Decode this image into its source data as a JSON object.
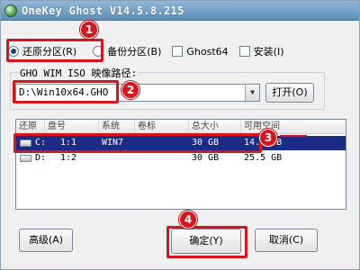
{
  "window": {
    "title": "OneKey Ghost V14.5.8.215"
  },
  "options": {
    "restore": "还原分区(R)",
    "backup": "备份分区(B)",
    "ghost64": "Ghost64",
    "install": "安装(I)"
  },
  "image_path": {
    "group_label": "GHO WIM ISO 映像路径:",
    "value": "D:\\Win10x64.GHO",
    "open_button": "打开(O)"
  },
  "partition_table": {
    "columns": [
      "还原",
      "盘号",
      "系统",
      "卷标",
      "总大小",
      "可用空间"
    ],
    "rows": [
      {
        "drive": "C:",
        "num": "1:1",
        "system": "WIN7",
        "label": "",
        "total": "30 GB",
        "free": "14.6 GB",
        "selected": true
      },
      {
        "drive": "D:",
        "num": "1:2",
        "system": "",
        "label": "",
        "total": "30 GB",
        "free": "25.5 GB",
        "selected": false
      }
    ]
  },
  "buttons": {
    "advanced": "高级(A)",
    "ok": "确定(Y)",
    "cancel": "取消(C)"
  },
  "annotations": {
    "b1": "1",
    "b2": "2",
    "b3": "3",
    "b4": "4"
  },
  "colors": {
    "annotation": "#d7151d",
    "selection": "#1b2c86"
  }
}
